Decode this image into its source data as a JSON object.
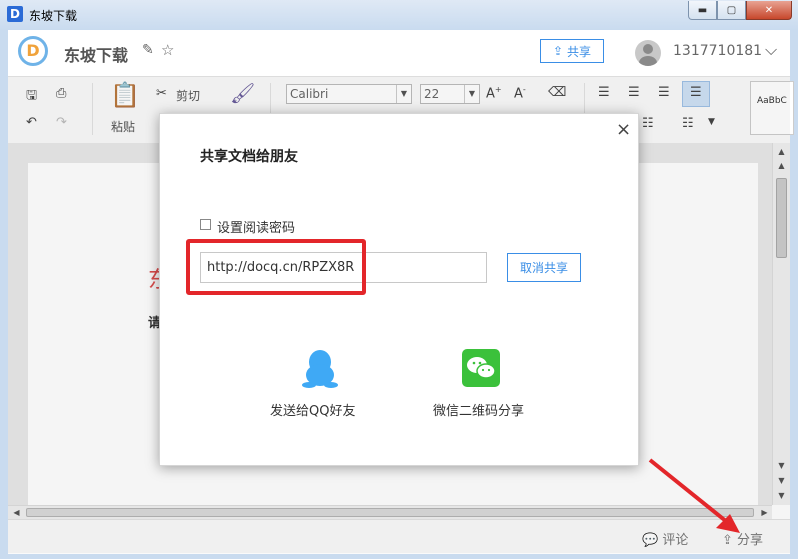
{
  "window": {
    "logo_letter": "D",
    "title": "东坡下载",
    "min_glyph": "▬",
    "max_glyph": "▢",
    "close_glyph": "✕"
  },
  "header": {
    "brand_letter": "D",
    "brand_name": "东坡下载",
    "share_label": "共享",
    "user_name": "1317710181"
  },
  "toolbar": {
    "paste_label": "粘贴",
    "cut_label": "剪切",
    "font_name": "Calibri",
    "font_size": "22",
    "style_preview": "AaBbC"
  },
  "document": {
    "red_text": "东",
    "black_text": "请"
  },
  "statusbar": {
    "comment_label": "评论",
    "share_label": "分享"
  },
  "modal": {
    "title": "共享文档给朋友",
    "password_label": "设置阅读密码",
    "share_link": "http://docq.cn/RPZX8R",
    "cancel_share_label": "取消共享",
    "qq_label": "发送给QQ好友",
    "wechat_label": "微信二维码分享"
  },
  "colors": {
    "accent": "#3a8ee6",
    "highlight": "#e3262a",
    "wechat_green": "#3bc13b",
    "qq_blue": "#3fa9f5"
  }
}
